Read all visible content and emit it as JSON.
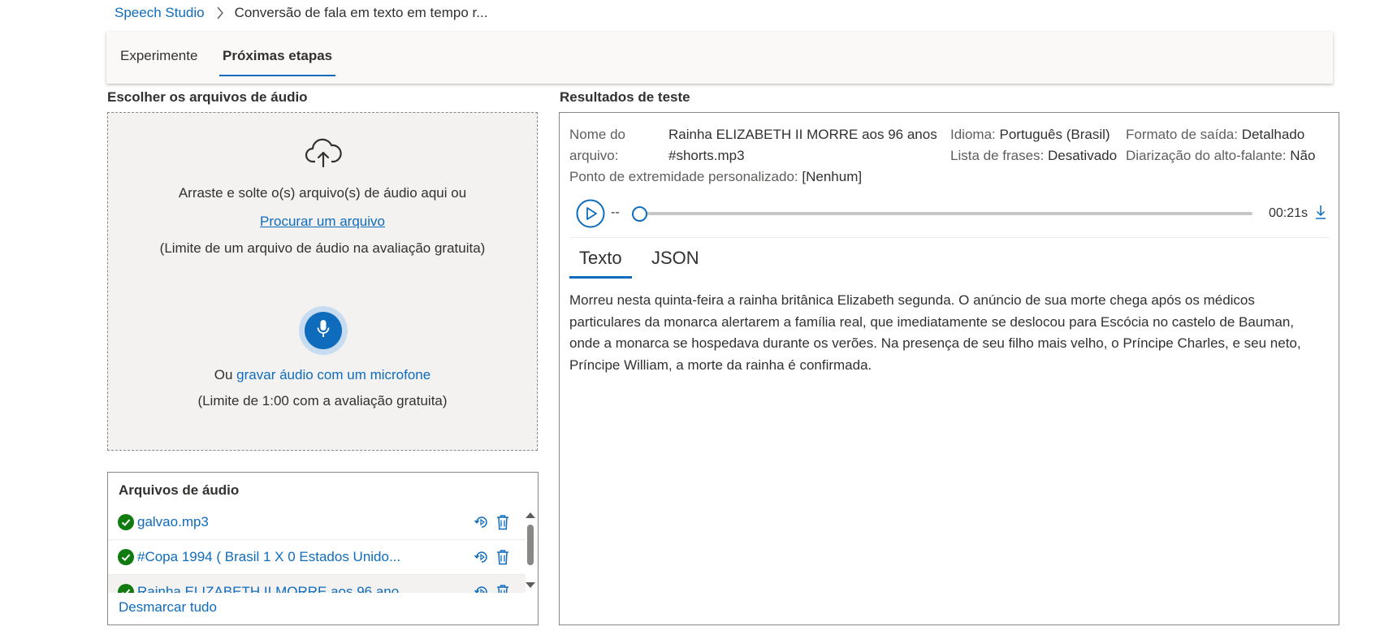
{
  "breadcrumb": {
    "root": "Speech Studio",
    "current": "Conversão de fala em texto em tempo r..."
  },
  "tabs": [
    {
      "label": "Experimente",
      "active": false
    },
    {
      "label": "Próximas etapas",
      "active": true
    }
  ],
  "left": {
    "title": "Escolher os arquivos de áudio",
    "dropzone": {
      "upload_icon": "cloud-upload-icon",
      "drag_text": "Arraste e solte o(s) arquivo(s) de áudio aqui ou",
      "browse_link": "Procurar um arquivo",
      "limit_text": "(Limite de um arquivo de áudio na avaliação gratuita)",
      "mic_icon": "microphone-icon",
      "or_text": "Ou ",
      "record_link": "gravar áudio com um microfone",
      "record_limit": "(Limite de 1:00 com a avaliação gratuita)"
    },
    "files": {
      "title": "Arquivos de áudio",
      "items": [
        {
          "name": "galvao.mp3",
          "status": "success",
          "selected": false
        },
        {
          "name": "#Copa 1994 ( Brasil 1 X 0 Estados Unido...",
          "status": "success",
          "selected": false
        },
        {
          "name": "Rainha ELIZABETH II MORRE aos 96 ano...",
          "status": "success",
          "selected": true
        }
      ],
      "deselect_label": "Desmarcar tudo"
    }
  },
  "results": {
    "title": "Resultados de teste",
    "file_name_label": "Nome do arquivo:",
    "file_name_label_line1": "Nome do",
    "file_name_label_line2": "arquivo:",
    "file_name_value_line1": "Rainha ELIZABETH II MORRE aos 96 anos",
    "file_name_value_line2": "#shorts.mp3",
    "language_label": "Idioma:",
    "language_value": "Português (Brasil)",
    "phrase_list_label": "Lista de frases:",
    "phrase_list_value": "Desativado",
    "output_format_label": "Formato de saída:",
    "output_format_value": "Detalhado",
    "diarization_label": "Diarização do alto-falante:",
    "diarization_value": "Não",
    "endpoint_label": "Ponto de extremidade personalizado:",
    "endpoint_value": "[Nenhum]",
    "player": {
      "position": "--",
      "duration": "00:21s",
      "progress": 0
    },
    "result_tabs": [
      {
        "label": "Texto",
        "active": true
      },
      {
        "label": "JSON",
        "active": false
      }
    ],
    "transcript": "Morreu nesta quinta-feira a rainha britânica Elizabeth segunda. O anúncio de sua morte chega após os médicos particulares da monarca alertarem a família real, que imediatamente se deslocou para Escócia no castelo de Bauman, onde a monarca se hospedava durante os verões. Na presença de seu filho mais velho, o Príncipe Charles, e seu neto, Príncipe William, a morte da rainha é confirmada."
  },
  "colors": {
    "accent": "#0f6cbd",
    "success": "#107c10",
    "dropzone_bg": "#f3f2f1",
    "text": "#323130"
  }
}
